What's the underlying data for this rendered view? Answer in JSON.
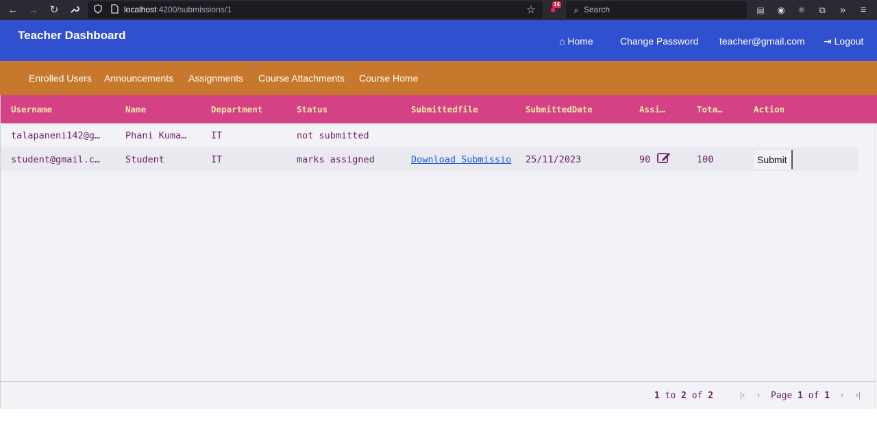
{
  "browser": {
    "url_host": "localhost",
    "url_rest": ":4200/submissions/1",
    "search_placeholder": "Search",
    "extension_badge": "14"
  },
  "header": {
    "brand": "Teacher Dashboard",
    "nav": {
      "home": "Home",
      "change_password": "Change Password",
      "user_email": "teacher@gmail.com",
      "logout": "Logout"
    }
  },
  "subnav": [
    "Enrolled Users",
    "Announcements",
    "Assignments",
    "Course Attachments",
    "Course Home"
  ],
  "grid": {
    "columns": [
      "Username",
      "Name",
      "Department",
      "Status",
      "Submittedfile",
      "SubmittedDate",
      "Assi…",
      "Tota…",
      "Action"
    ],
    "rows": [
      {
        "username": "talapaneni142@g…",
        "name": "Phani Kuma…",
        "department": "IT",
        "status": "not submitted",
        "file": "",
        "date": "",
        "marks": "",
        "total": "",
        "action": ""
      },
      {
        "username": "student@gmail.c…",
        "name": "Student",
        "department": "IT",
        "status": "marks assigned",
        "file": "Download Submissio",
        "date": "25/11/2023",
        "marks": "90",
        "total": "100",
        "action": "Submit"
      }
    ],
    "pager": {
      "range_start": "1",
      "to": "to",
      "range_end": "2",
      "of": "of",
      "total": "2",
      "page_label": "Page",
      "page": "1",
      "page_of": "of",
      "page_total": "1"
    }
  },
  "colors": {
    "header": "#3150cf",
    "subnav": "#c7782c",
    "grid_header": "#d44185",
    "text": "#6a1d6a"
  }
}
